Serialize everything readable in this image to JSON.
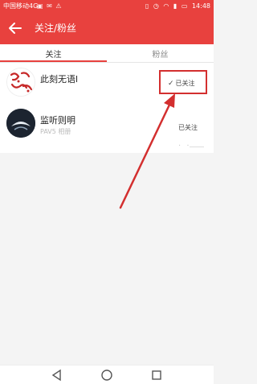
{
  "status_bar": {
    "carrier": "中国移动4G",
    "time": "14:48",
    "icons": [
      "notification-icon",
      "wifi-icon",
      "signal-icon",
      "battery-icon"
    ]
  },
  "app_bar": {
    "title": "关注/粉丝"
  },
  "tabs": [
    {
      "label": "关注",
      "selected": true
    },
    {
      "label": "粉丝",
      "selected": false
    }
  ],
  "follow_list": [
    {
      "name": "此刻无语l",
      "subtitle": "",
      "follow_label": "已关注"
    },
    {
      "name": "监听则明",
      "subtitle": "PAV5 相册",
      "follow_label": "已关注"
    }
  ],
  "colors": {
    "accent": "#e8413e",
    "annotation": "#d32f2f"
  }
}
